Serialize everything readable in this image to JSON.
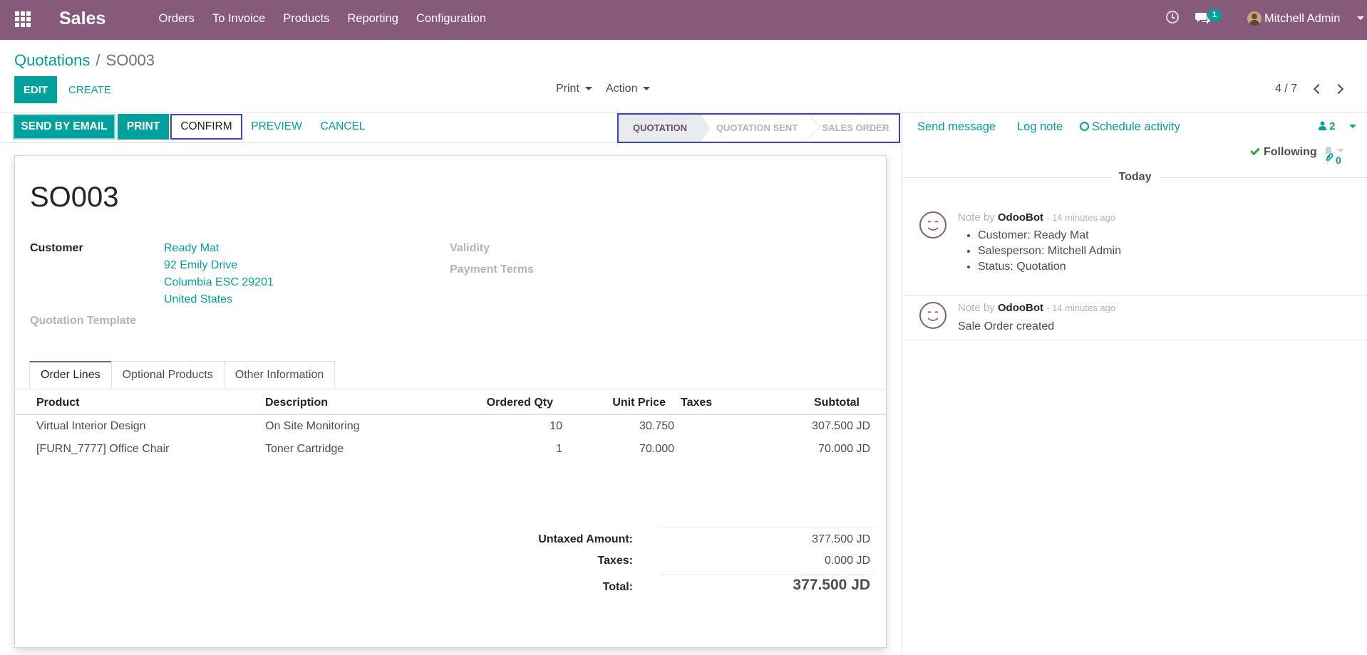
{
  "app": {
    "brand": "Sales"
  },
  "topmenu": [
    "Orders",
    "To Invoice",
    "Products",
    "Reporting",
    "Configuration"
  ],
  "systray": {
    "chat_count": "1",
    "user": "Mitchell Admin"
  },
  "breadcrumb": {
    "parent": "Quotations",
    "separator": "/",
    "current": "SO003"
  },
  "control": {
    "edit": "EDIT",
    "create": "CREATE",
    "print_dd": "Print",
    "action_dd": "Action",
    "pager": "4 / 7"
  },
  "header_buttons": {
    "send_email": "SEND BY EMAIL",
    "print": "PRINT",
    "confirm": "CONFIRM",
    "preview": "PREVIEW",
    "cancel": "CANCEL"
  },
  "stages": [
    "QUOTATION",
    "QUOTATION SENT",
    "SALES ORDER"
  ],
  "active_stage": "QUOTATION",
  "form": {
    "title": "SO003",
    "customer_label": "Customer",
    "customer_lines": [
      "Ready Mat",
      "92 Emily Drive",
      "Columbia ESC 29201",
      "United States"
    ],
    "validity_label": "Validity",
    "payment_terms_label": "Payment Terms",
    "template_label": "Quotation Template"
  },
  "tabs": [
    "Order Lines",
    "Optional Products",
    "Other Information"
  ],
  "table": {
    "columns": [
      "Product",
      "Description",
      "Ordered Qty",
      "Unit Price",
      "Taxes",
      "Subtotal"
    ],
    "rows": [
      {
        "product": "Virtual Interior Design",
        "description": "On Site Monitoring",
        "qty": "10",
        "unit_price": "30.750",
        "taxes": "",
        "subtotal": "307.500 JD"
      },
      {
        "product": "[FURN_7777] Office Chair",
        "description": "Toner Cartridge",
        "qty": "1",
        "unit_price": "70.000",
        "taxes": "",
        "subtotal": "70.000 JD"
      }
    ]
  },
  "totals": {
    "untaxed_label": "Untaxed Amount:",
    "untaxed_value": "377.500 JD",
    "taxes_label": "Taxes:",
    "taxes_value": "0.000 JD",
    "total_label": "Total:",
    "total_value": "377.500 JD"
  },
  "chatter": {
    "send_message": "Send message",
    "log_note": "Log note",
    "schedule_activity": "Schedule activity",
    "followers_count": "2",
    "following": "Following",
    "attachments_count": "0",
    "today": "Today",
    "messages": [
      {
        "prefix": "Note by",
        "author": "OdooBot",
        "date": "- 14 minutes ago",
        "bullets": [
          "Customer: Ready Mat",
          "Salesperson: Mitchell Admin",
          "Status: Quotation"
        ]
      },
      {
        "prefix": "Note by",
        "author": "OdooBot",
        "date": "- 14 minutes ago",
        "body": "Sale Order created"
      }
    ]
  },
  "colors": {
    "brand": "#875a7b",
    "accent": "#00a09d",
    "highlight": "#3b43c4"
  }
}
